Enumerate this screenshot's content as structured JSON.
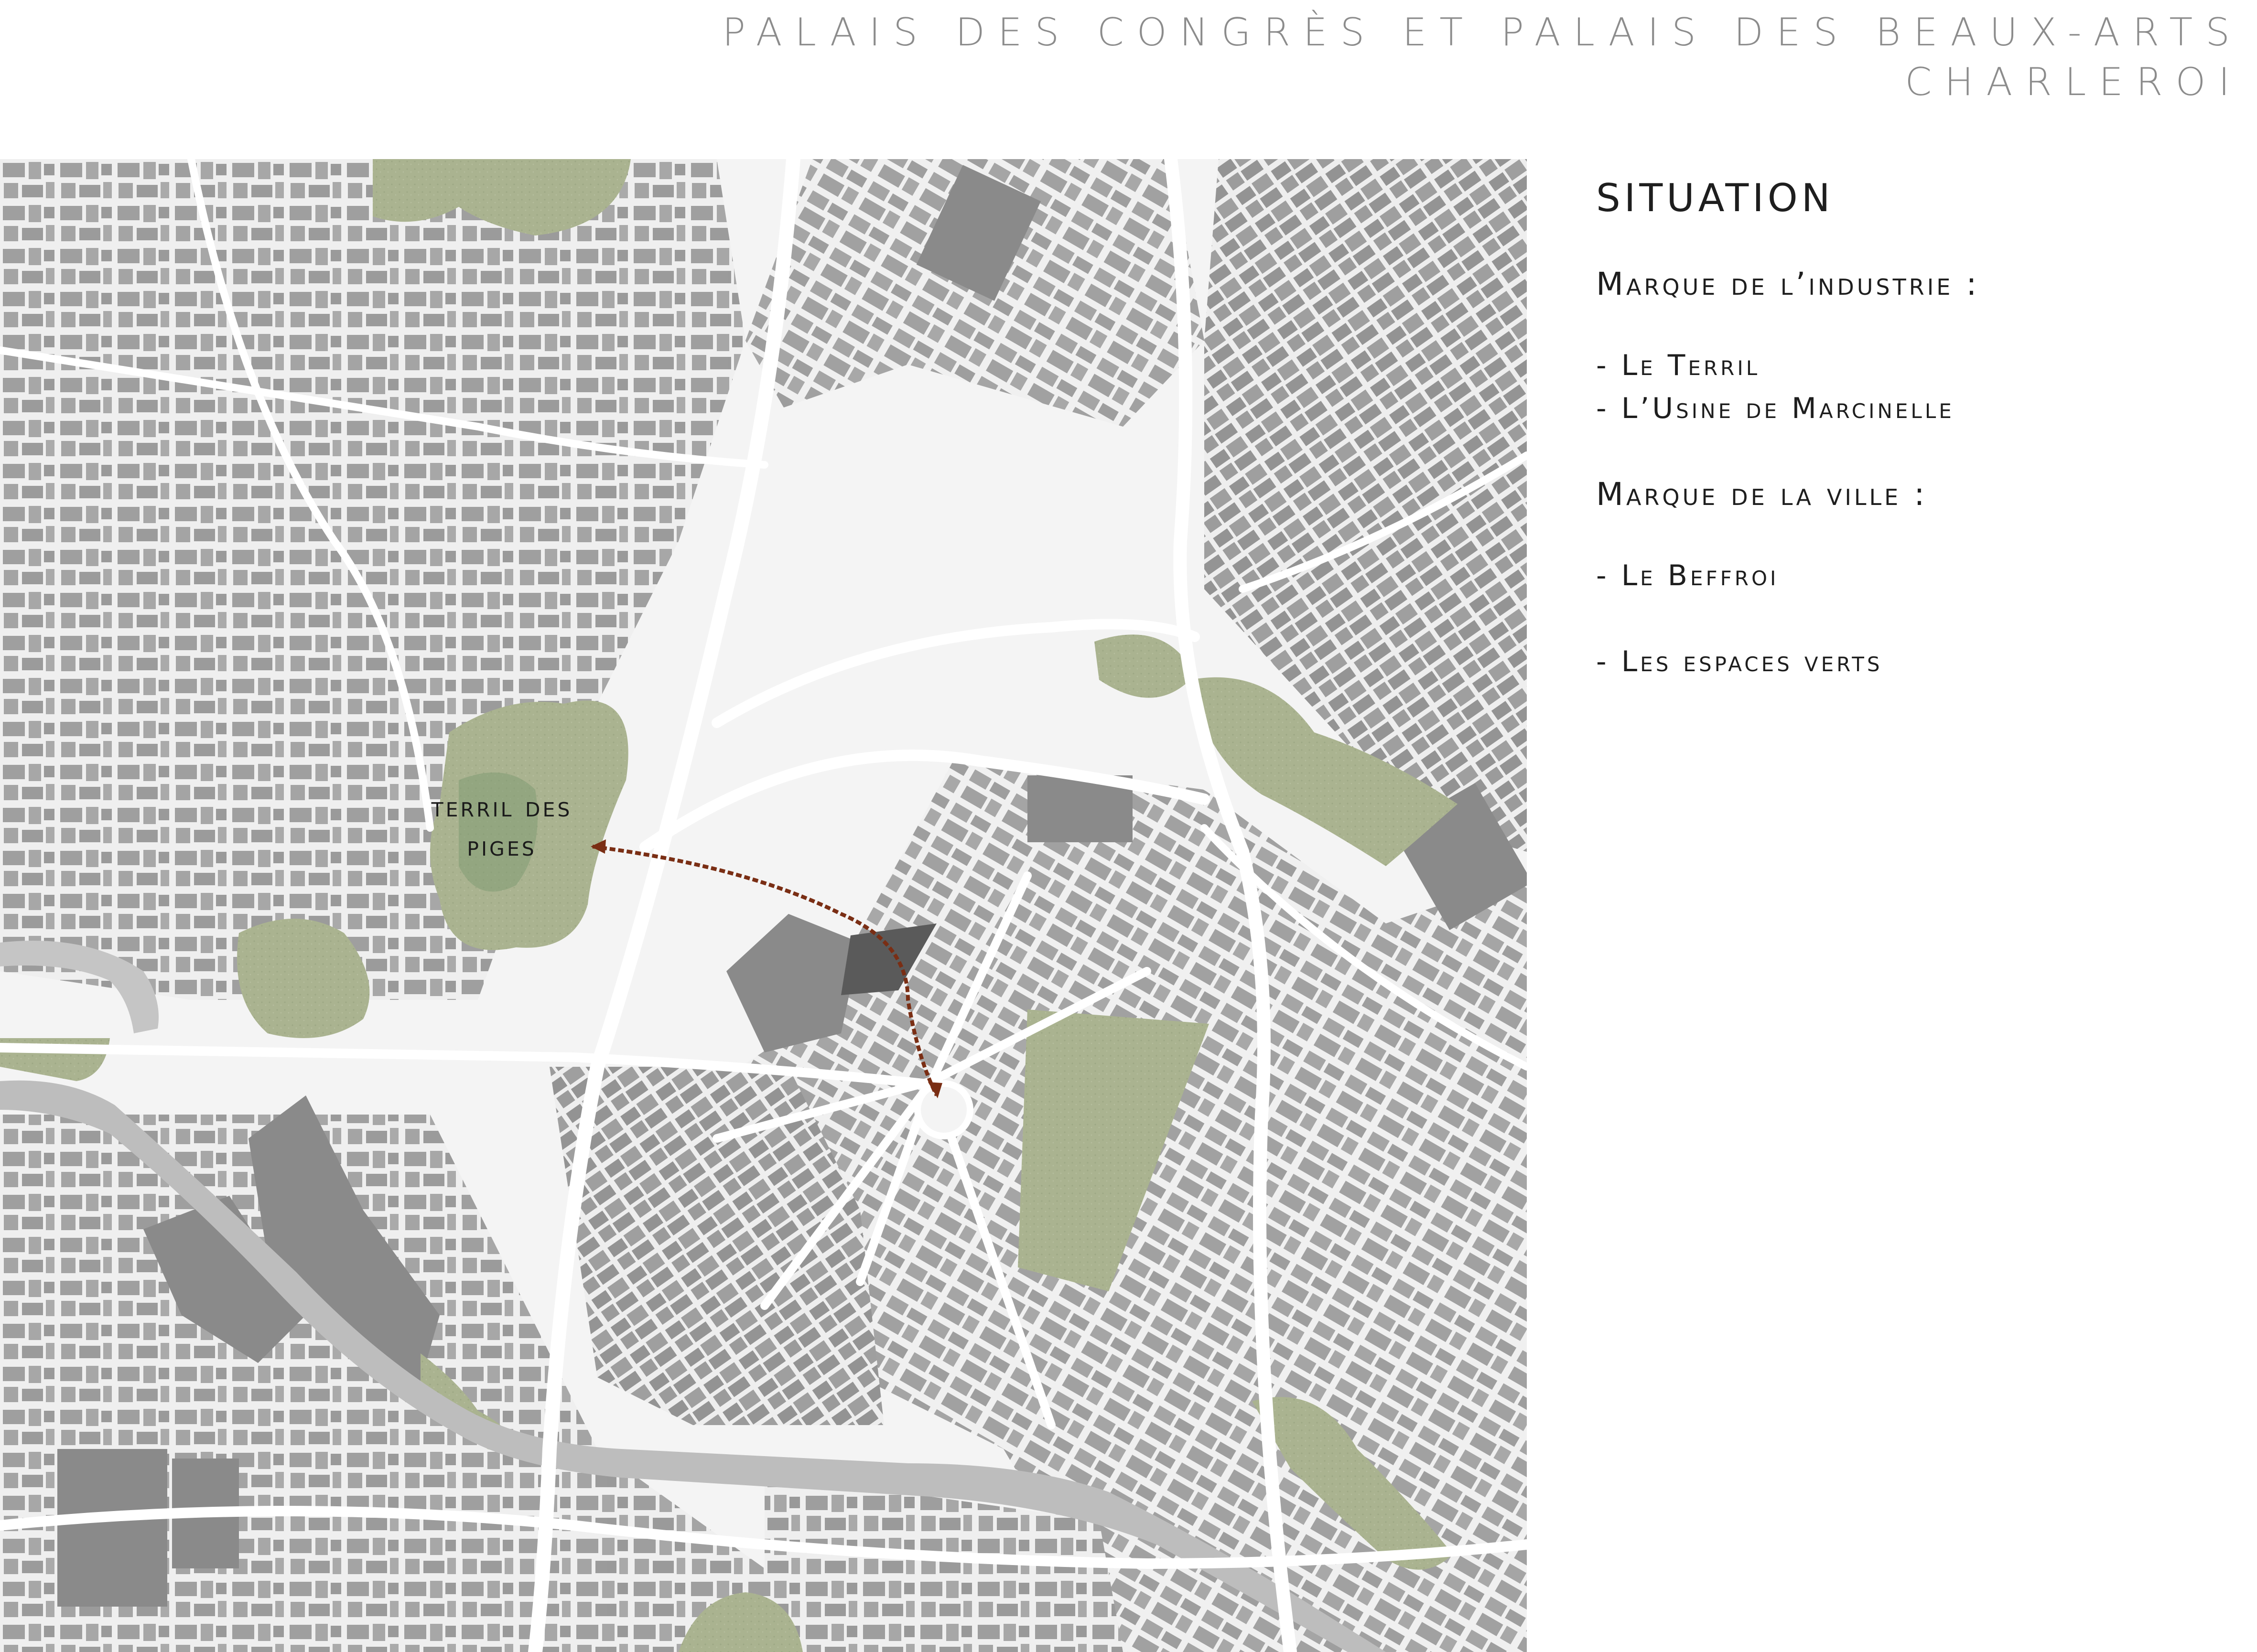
{
  "header": {
    "title_line1": "PALAIS DES CONGRÈS ET PALAIS DES BEAUX-ARTS",
    "title_line2": "CHARLEROI"
  },
  "legend": {
    "heading": "SITUATION",
    "section_industry": "Marque de l’industrie :",
    "industry_items": [
      "- Le Terril",
      "- L’Usine de Marcinelle"
    ],
    "section_city": "Marque de la ville :",
    "city_items": [
      "- Le Beffroi",
      "- Les espaces verts"
    ]
  },
  "map": {
    "label_line1": "terril des",
    "label_line2": "piges",
    "colors": {
      "background": "#f4f4f4",
      "street": "#ffffff",
      "building": "#9a9a9a",
      "building_dark": "#6e6e6e",
      "project_site": "#5a5a5a",
      "green_space": "#a9b28f",
      "green_dark": "#7f9a73",
      "canal": "#bdbdbd",
      "arrow": "#7a2e14"
    },
    "icons": [
      "map-arrow-icon"
    ]
  }
}
